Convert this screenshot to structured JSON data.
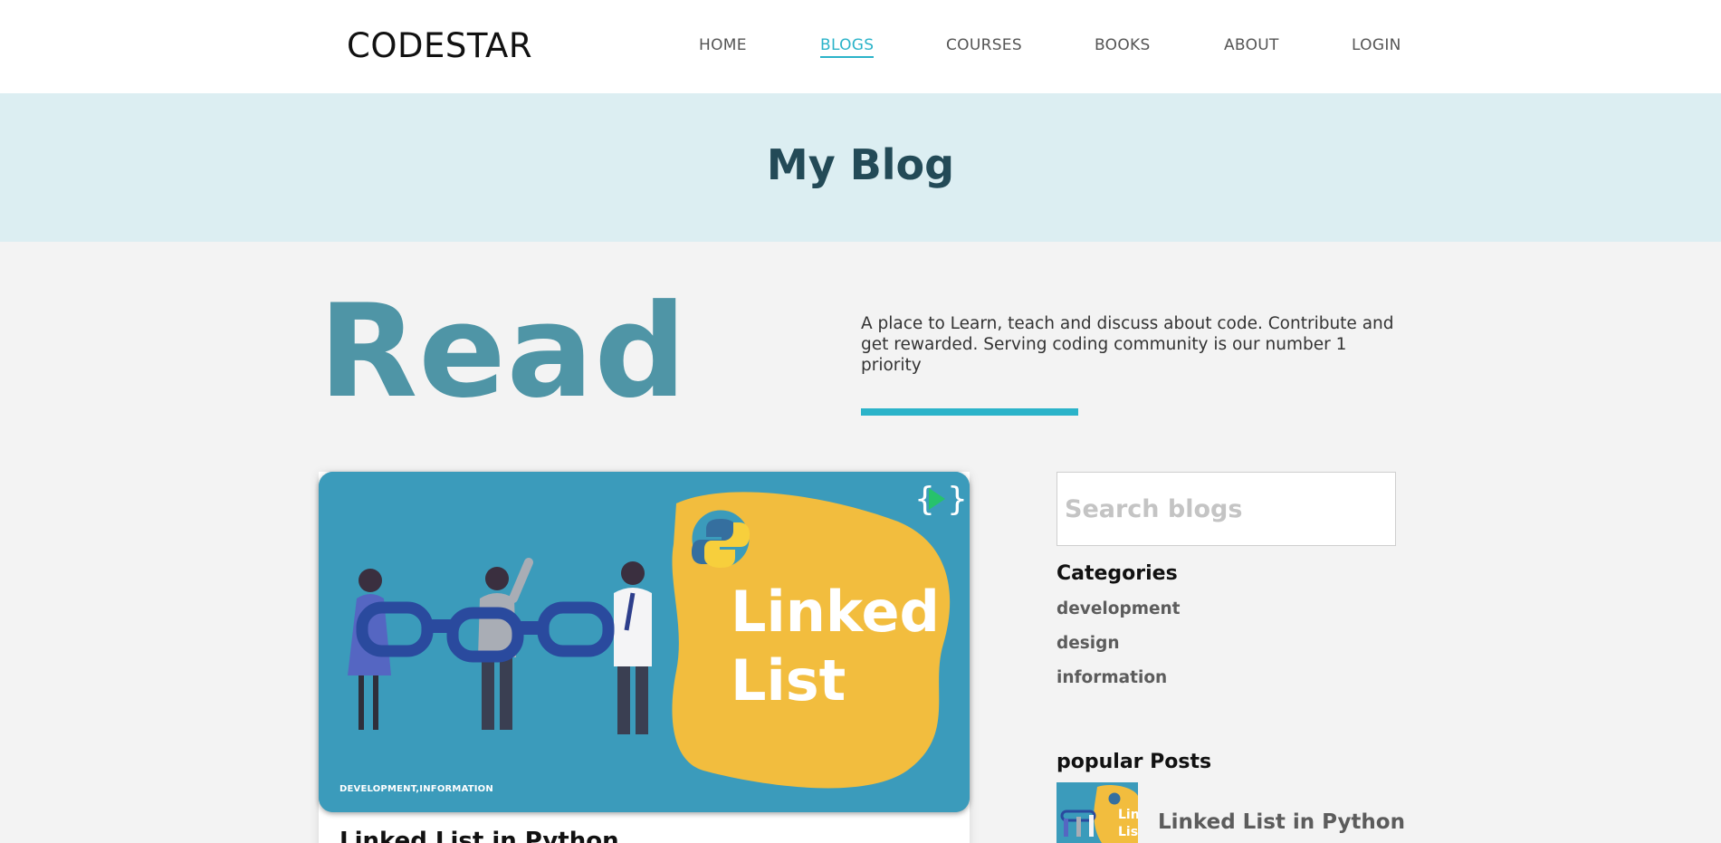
{
  "brand": {
    "logo": "CODESTAR"
  },
  "nav": {
    "items": [
      {
        "label": "HOME",
        "active": false
      },
      {
        "label": "BLOGS",
        "active": true
      },
      {
        "label": "COURSES",
        "active": false
      },
      {
        "label": "BOOKS",
        "active": false
      },
      {
        "label": "ABOUT",
        "active": false
      },
      {
        "label": "LOGIN",
        "active": false
      }
    ]
  },
  "banner": {
    "title": "My Blog"
  },
  "intro": {
    "big_word": "Read",
    "description": "A place to Learn, teach and discuss about code. Contribute and get rewarded. Serving coding community is our number 1 priority"
  },
  "featured_post": {
    "image_text": [
      "Linked",
      "List"
    ],
    "tags": "DEVELOPMENT,INFORMATION",
    "title": "Linked List in Python"
  },
  "sidebar": {
    "search_placeholder": "Search blogs",
    "categories_heading": "Categories",
    "categories": [
      "development",
      "design",
      "information"
    ],
    "popular_heading": "popular Posts",
    "popular_posts": [
      {
        "title": "Linked List in Python",
        "thumb_text": [
          "Lin",
          "Lis"
        ]
      }
    ]
  },
  "colors": {
    "accent": "#2bb3c9",
    "banner_bg": "#dceef2",
    "banner_title": "#234a57",
    "read_word": "#4f95a6",
    "image_blue": "#3b9bbb",
    "image_yellow": "#f2bd3e"
  },
  "icons": [
    "codestar-bracket-play-icon",
    "python-logo-icon"
  ]
}
